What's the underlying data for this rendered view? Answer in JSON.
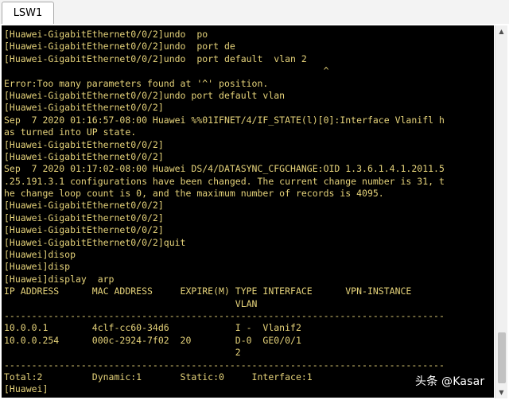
{
  "tabs": [
    {
      "label": "LSW1"
    }
  ],
  "terminal": {
    "lines": [
      "[Huawei-GigabitEthernet0/0/2]undo  po",
      "[Huawei-GigabitEthernet0/0/2]undo  port de",
      "[Huawei-GigabitEthernet0/0/2]undo  port default  vlan 2",
      "                                                          ^",
      "Error:Too many parameters found at '^' position.",
      "[Huawei-GigabitEthernet0/0/2]undo port default vlan",
      "[Huawei-GigabitEthernet0/0/2]",
      "Sep  7 2020 01:16:57-08:00 Huawei %%01IFNET/4/IF_STATE(l)[0]:Interface Vlanifl h",
      "as turned into UP state.",
      "[Huawei-GigabitEthernet0/0/2]",
      "[Huawei-GigabitEthernet0/0/2]",
      "Sep  7 2020 01:17:02-08:00 Huawei DS/4/DATASYNC_CFGCHANGE:OID 1.3.6.1.4.1.2011.5",
      ".25.191.3.1 configurations have been changed. The current change number is 31, t",
      "he change loop count is 0, and the maximum number of records is 4095.",
      "[Huawei-GigabitEthernet0/0/2]",
      "[Huawei-GigabitEthernet0/0/2]",
      "[Huawei-GigabitEthernet0/0/2]",
      "[Huawei-GigabitEthernet0/0/2]quit",
      "[Huawei]disop",
      "[Huawei]disp",
      "[Huawei]display  arp",
      "IP ADDRESS      MAC ADDRESS     EXPIRE(M) TYPE INTERFACE      VPN-INSTANCE",
      "                                          VLAN",
      "--------------------------------------------------------------------------------",
      "10.0.0.1        4clf-cc60-34d6            I -  Vlanif2",
      "10.0.0.254      000c-2924-7f02  20        D-0  GE0/0/1",
      "                                          2",
      "--------------------------------------------------------------------------------",
      "Total:2         Dynamic:1       Static:0     Interface:1",
      "[Huawei]"
    ]
  },
  "watermark": "头条 @Kasar",
  "scrollbar": {
    "up_arrow": "▲",
    "down_arrow": "▼"
  },
  "colors": {
    "terminal_background": "#000000",
    "terminal_text": "#e6d37a"
  }
}
